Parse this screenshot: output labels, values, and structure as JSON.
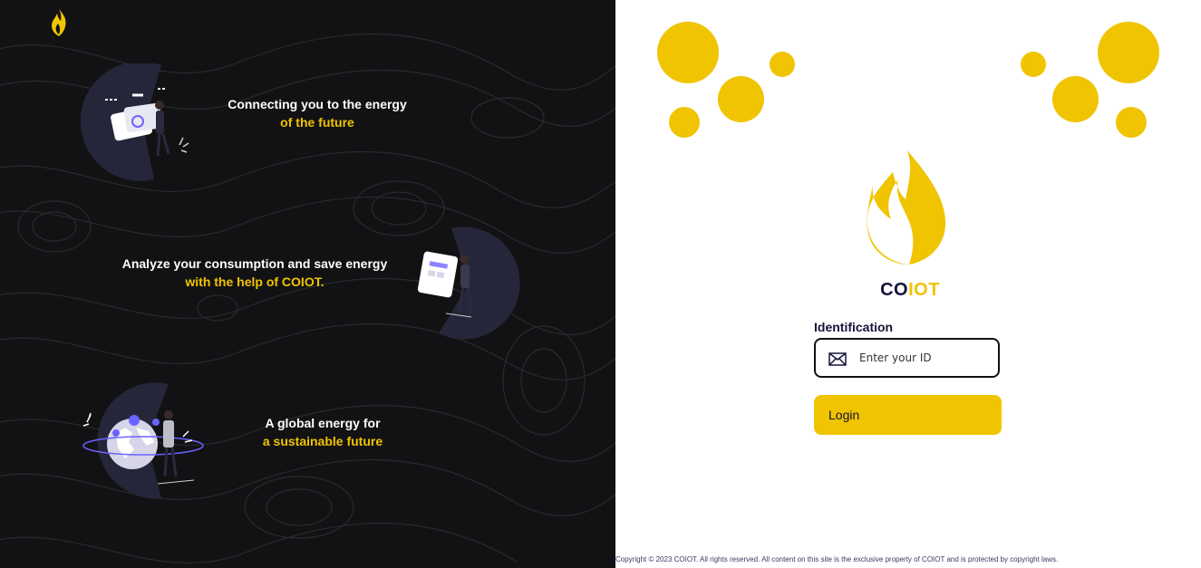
{
  "left_panel": {
    "brand_icon": "flame-icon",
    "features": [
      {
        "line1": "Connecting you to the energy",
        "line2": "of the future",
        "illustration": "card-payment-illustration"
      },
      {
        "line1": "Analyze your consumption and save energy",
        "line2": "with the help of COIOT.",
        "illustration": "document-analysis-illustration"
      },
      {
        "line1": "A global energy for",
        "line2": "a sustainable future",
        "illustration": "globe-illustration"
      }
    ]
  },
  "login": {
    "logo_part1": "CO",
    "logo_part2": "IOT",
    "id_label": "Identification",
    "id_placeholder": "Enter your ID",
    "id_value": "",
    "login_label": "Login"
  },
  "footer": {
    "copyright": "Copyright © 2023 COIOT. All rights reserved. All content on this site is the exclusive property of COIOT and is protected by copyright laws."
  },
  "colors": {
    "accent": "#f0c400",
    "dark_bg": "#121214",
    "navy": "#14143a"
  }
}
